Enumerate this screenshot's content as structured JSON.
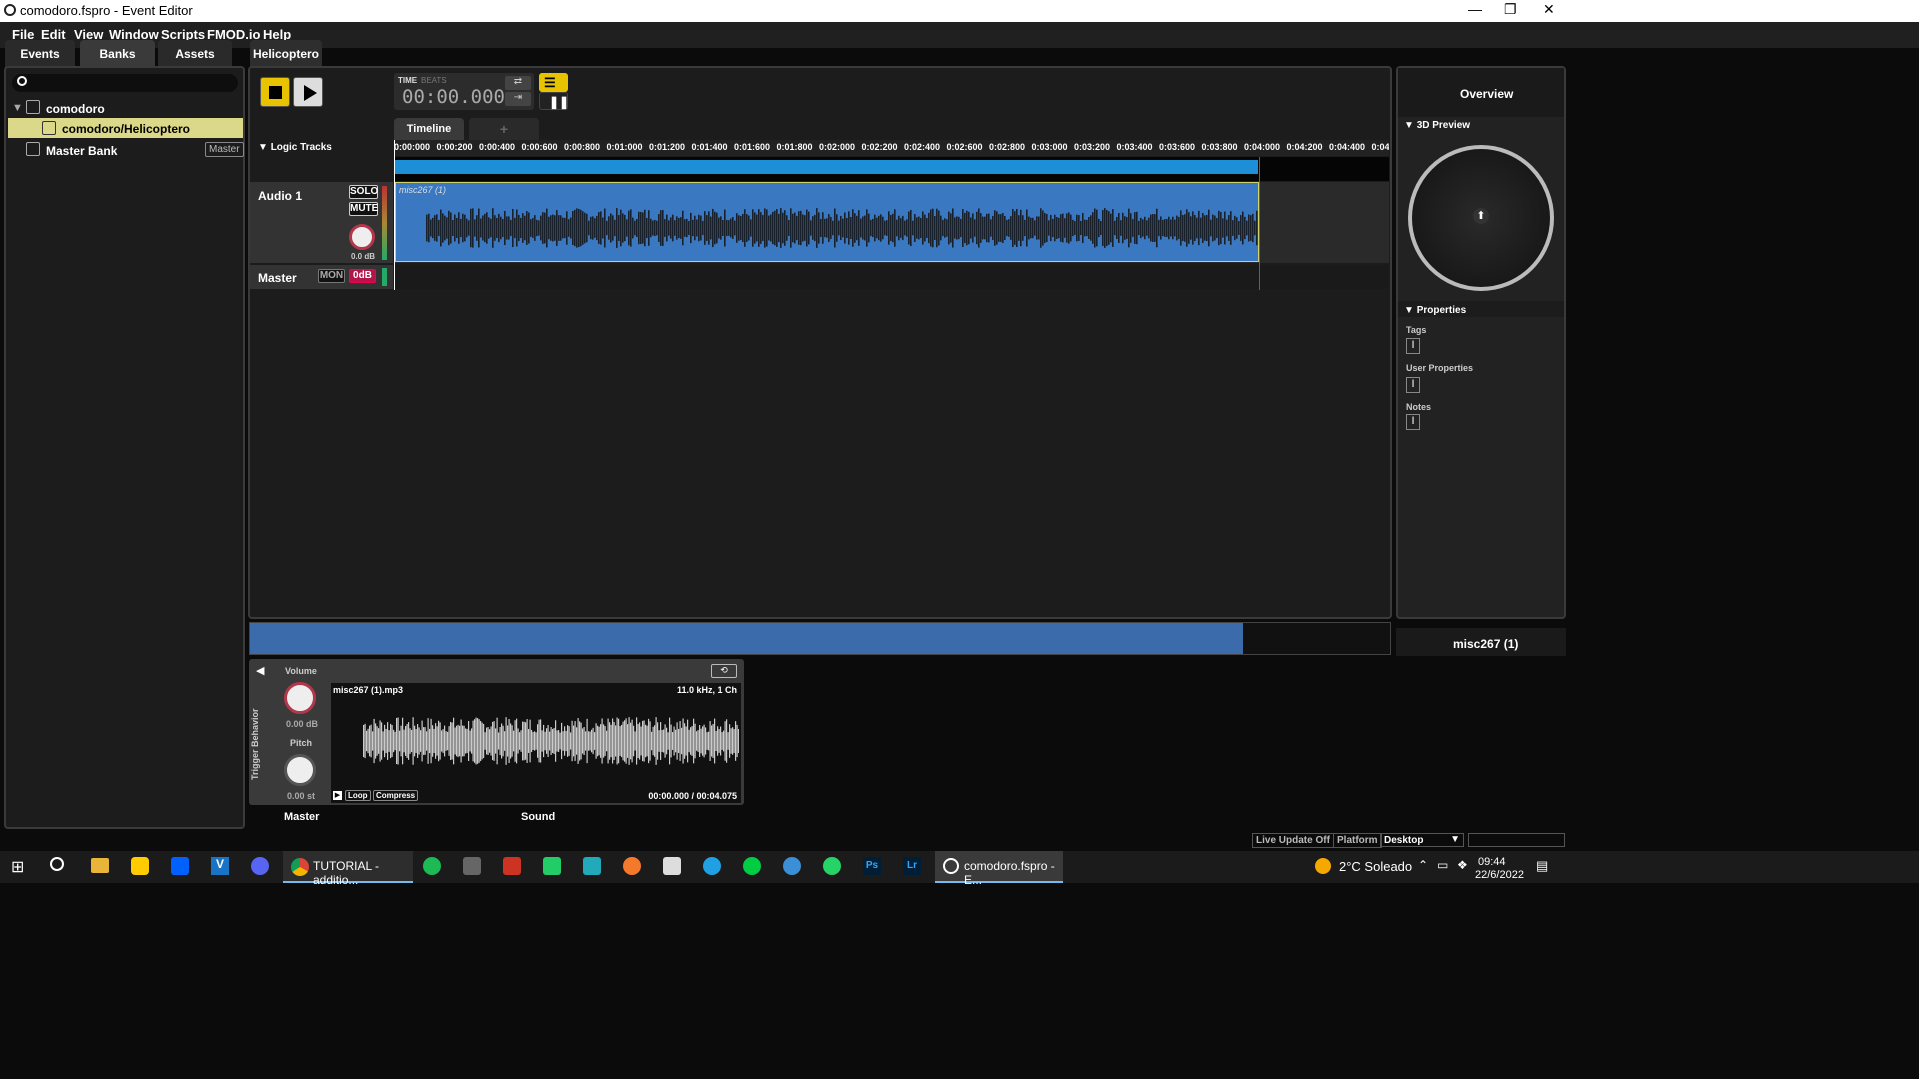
{
  "window": {
    "title": "comodoro.fspro - Event Editor",
    "controls": [
      "—",
      "❐",
      "✕"
    ]
  },
  "menu": [
    "File",
    "Edit",
    "View",
    "Window",
    "Scripts",
    "FMOD.io",
    "Help"
  ],
  "browser": {
    "tabs": [
      "Events",
      "Banks",
      "Assets"
    ],
    "active_tab": "Banks",
    "search_placeholder": "",
    "tree": {
      "root": "comodoro",
      "selected_item": "comodoro/Helicoptero",
      "master_bank": "Master Bank",
      "master_badge": "Master"
    }
  },
  "editor": {
    "event_tab": "Helicoptero",
    "time_label": "TIME",
    "beats_label": "BEATS",
    "time_value": "00:00.000",
    "timeline_tab": "Timeline",
    "add_tab": "+",
    "logic_tracks": "Logic Tracks",
    "ticks": [
      "0:00:000",
      "0:00:200",
      "0:00:400",
      "0:00:600",
      "0:00:800",
      "0:01:000",
      "0:01:200",
      "0:01:400",
      "0:01:600",
      "0:01:800",
      "0:02:000",
      "0:02:200",
      "0:02:400",
      "0:02:600",
      "0:02:800",
      "0:03:000",
      "0:03:200",
      "0:03:400",
      "0:03:600",
      "0:03:800",
      "0:04:000",
      "0:04:200",
      "0:04:400",
      "0:04"
    ],
    "tracks": {
      "audio_name": "Audio 1",
      "solo": "SOLO",
      "mute": "MUTE",
      "volume": "0.0 dB",
      "clip_name": "misc267 (1)",
      "master_name": "Master",
      "mon": "MON",
      "odb": "0dB"
    }
  },
  "overview": {
    "title": "Overview",
    "preview_3d": "3D Preview",
    "properties": "Properties",
    "tags": "Tags",
    "user_properties": "User Properties",
    "notes": "Notes",
    "selected_name": "misc267 (1)"
  },
  "deck": {
    "volume_label": "Volume",
    "volume_value": "0.00 dB",
    "pitch_label": "Pitch",
    "pitch_value": "0.00 st",
    "trigger": "Trigger Behavior",
    "file": "misc267 (1).mp3",
    "format": "11.0 kHz, 1 Ch",
    "loop": "Loop",
    "compress": "Compress",
    "position": "00:00.000 / 00:04.075",
    "master_label": "Master",
    "sound_label": "Sound"
  },
  "statusbar": {
    "live_update": "Live Update Off",
    "platform_label": "Platform",
    "platform_value": "Desktop"
  },
  "taskbar": {
    "chrome_label": "TUTORIAL - additio...",
    "fmod_label": "comodoro.fspro - E...",
    "weather": "2°C  Soleado",
    "time": "09:44",
    "date": "22/6/2022",
    "ps": "Ps",
    "lr": "Lr"
  }
}
